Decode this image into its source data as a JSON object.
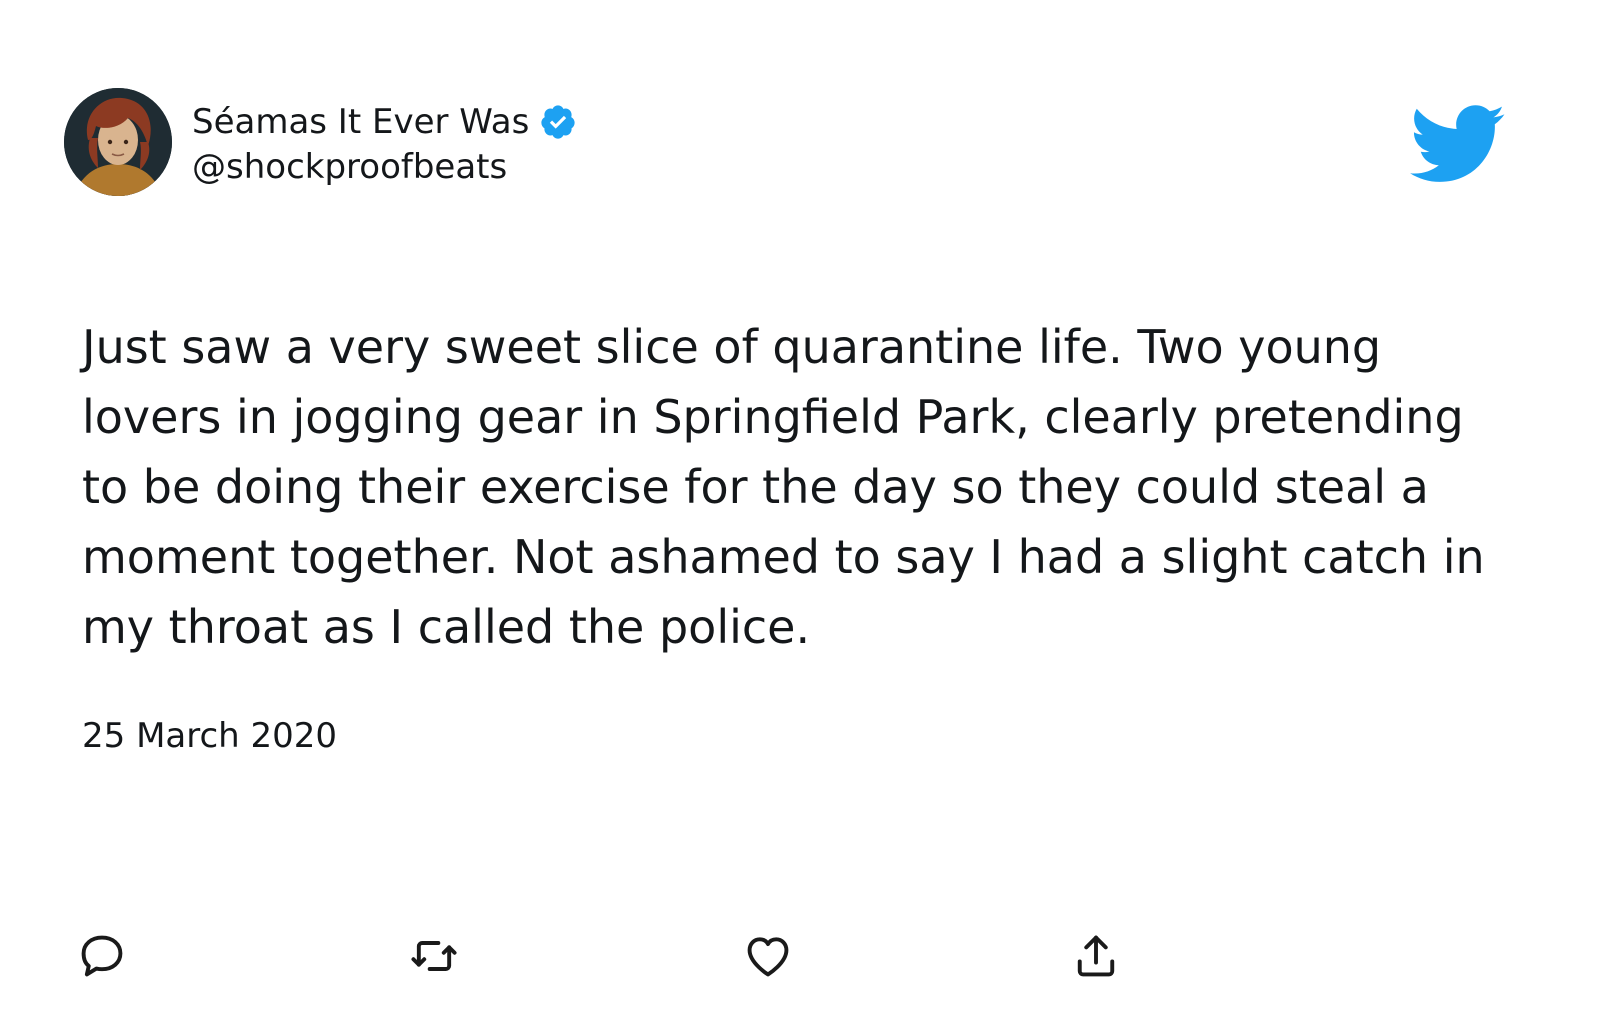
{
  "author": {
    "display_name": "Séamas It Ever Was",
    "handle": "@shockproofbeats",
    "verified": true
  },
  "tweet": {
    "text": "Just saw a very sweet slice of quarantine life. Two young lovers in jogging gear in Springfield Park, clearly pretending to be doing their exercise for the day so they could steal a moment together. Not ashamed to say I had a slight catch in my throat as I called the police.",
    "date": "25 March 2020"
  },
  "icons": {
    "brand": "twitter-bird-icon",
    "verified": "verified-badge-icon",
    "actions": [
      "reply-icon",
      "retweet-icon",
      "like-icon",
      "share-icon"
    ]
  },
  "colors": {
    "twitter_blue": "#1da1f2",
    "text": "#14171a",
    "icon_gray": "#1a1a1a"
  }
}
